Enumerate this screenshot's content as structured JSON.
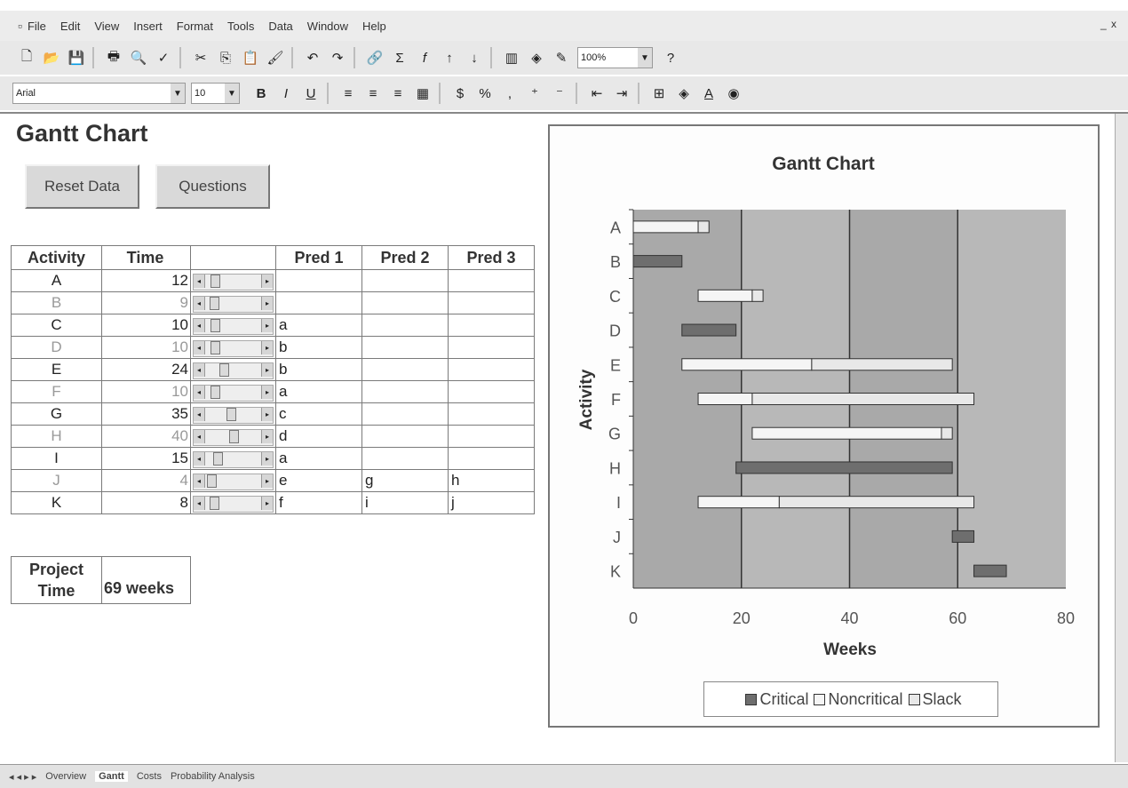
{
  "menu": {
    "items": [
      "File",
      "Edit",
      "View",
      "Insert",
      "Format",
      "Tools",
      "Data",
      "Window",
      "Help"
    ],
    "right_control": "_ x"
  },
  "toolbar": {
    "zoom": "100%",
    "font": "Arial",
    "font_size": "10"
  },
  "sheet": {
    "title": "Gantt Chart",
    "reset_button": "Reset Data",
    "questions_button": "Questions",
    "table": {
      "headers": [
        "Activity",
        "Time",
        "",
        "Pred 1",
        "Pred 2",
        "Pred 3"
      ],
      "rows": [
        {
          "activity": "A",
          "time": "12",
          "scroll": 0.1,
          "pred1": "",
          "pred2": "",
          "pred3": ""
        },
        {
          "activity": "B",
          "time": "9",
          "scroll": 0.08,
          "pred1": "",
          "pred2": "",
          "pred3": ""
        },
        {
          "activity": "C",
          "time": "10",
          "scroll": 0.09,
          "pred1": "a",
          "pred2": "",
          "pred3": ""
        },
        {
          "activity": "D",
          "time": "10",
          "scroll": 0.09,
          "pred1": "b",
          "pred2": "",
          "pred3": ""
        },
        {
          "activity": "E",
          "time": "24",
          "scroll": 0.3,
          "pred1": "b",
          "pred2": "",
          "pred3": ""
        },
        {
          "activity": "F",
          "time": "10",
          "scroll": 0.09,
          "pred1": "a",
          "pred2": "",
          "pred3": ""
        },
        {
          "activity": "G",
          "time": "35",
          "scroll": 0.45,
          "pred1": "c",
          "pred2": "",
          "pred3": ""
        },
        {
          "activity": "H",
          "time": "40",
          "scroll": 0.52,
          "pred1": "d",
          "pred2": "",
          "pred3": ""
        },
        {
          "activity": "I",
          "time": "15",
          "scroll": 0.16,
          "pred1": "a",
          "pred2": "",
          "pred3": ""
        },
        {
          "activity": "J",
          "time": "4",
          "scroll": 0.02,
          "pred1": "e",
          "pred2": "g",
          "pred3": "h"
        },
        {
          "activity": "K",
          "time": "8",
          "scroll": 0.07,
          "pred1": "f",
          "pred2": "i",
          "pred3": "j"
        }
      ]
    },
    "project_time_label_1": "Project",
    "project_time_label_2": "Time",
    "project_time_value": "69 weeks"
  },
  "chart_data": {
    "type": "bar",
    "orientation": "horizontal-stacked",
    "title": "Gantt Chart",
    "xlabel": "Weeks",
    "ylabel": "Activity",
    "xlim": [
      0,
      80
    ],
    "xticks": [
      0,
      20,
      40,
      60,
      80
    ],
    "categories": [
      "A",
      "B",
      "C",
      "D",
      "E",
      "F",
      "G",
      "H",
      "I",
      "J",
      "K"
    ],
    "start": [
      0,
      0,
      12,
      9,
      9,
      12,
      22,
      19,
      12,
      59,
      63
    ],
    "series": [
      {
        "name": "Critical",
        "color": "#6e6e6e",
        "values": [
          0,
          9,
          0,
          10,
          0,
          0,
          0,
          40,
          0,
          4,
          6
        ]
      },
      {
        "name": "Noncritical",
        "color": "#f5f5f5",
        "values": [
          12,
          0,
          10,
          0,
          24,
          10,
          35,
          0,
          15,
          0,
          0
        ]
      },
      {
        "name": "Slack",
        "color": "#e8e8e8",
        "values": [
          2,
          0,
          2,
          0,
          26,
          41,
          2,
          0,
          36,
          0,
          0
        ]
      }
    ],
    "grid": true,
    "plot_bg": "#a9a9a9",
    "legend_position": "bottom"
  },
  "sheet_tabs": [
    "Overview",
    "Gantt",
    "Costs",
    "Probability Analysis"
  ]
}
